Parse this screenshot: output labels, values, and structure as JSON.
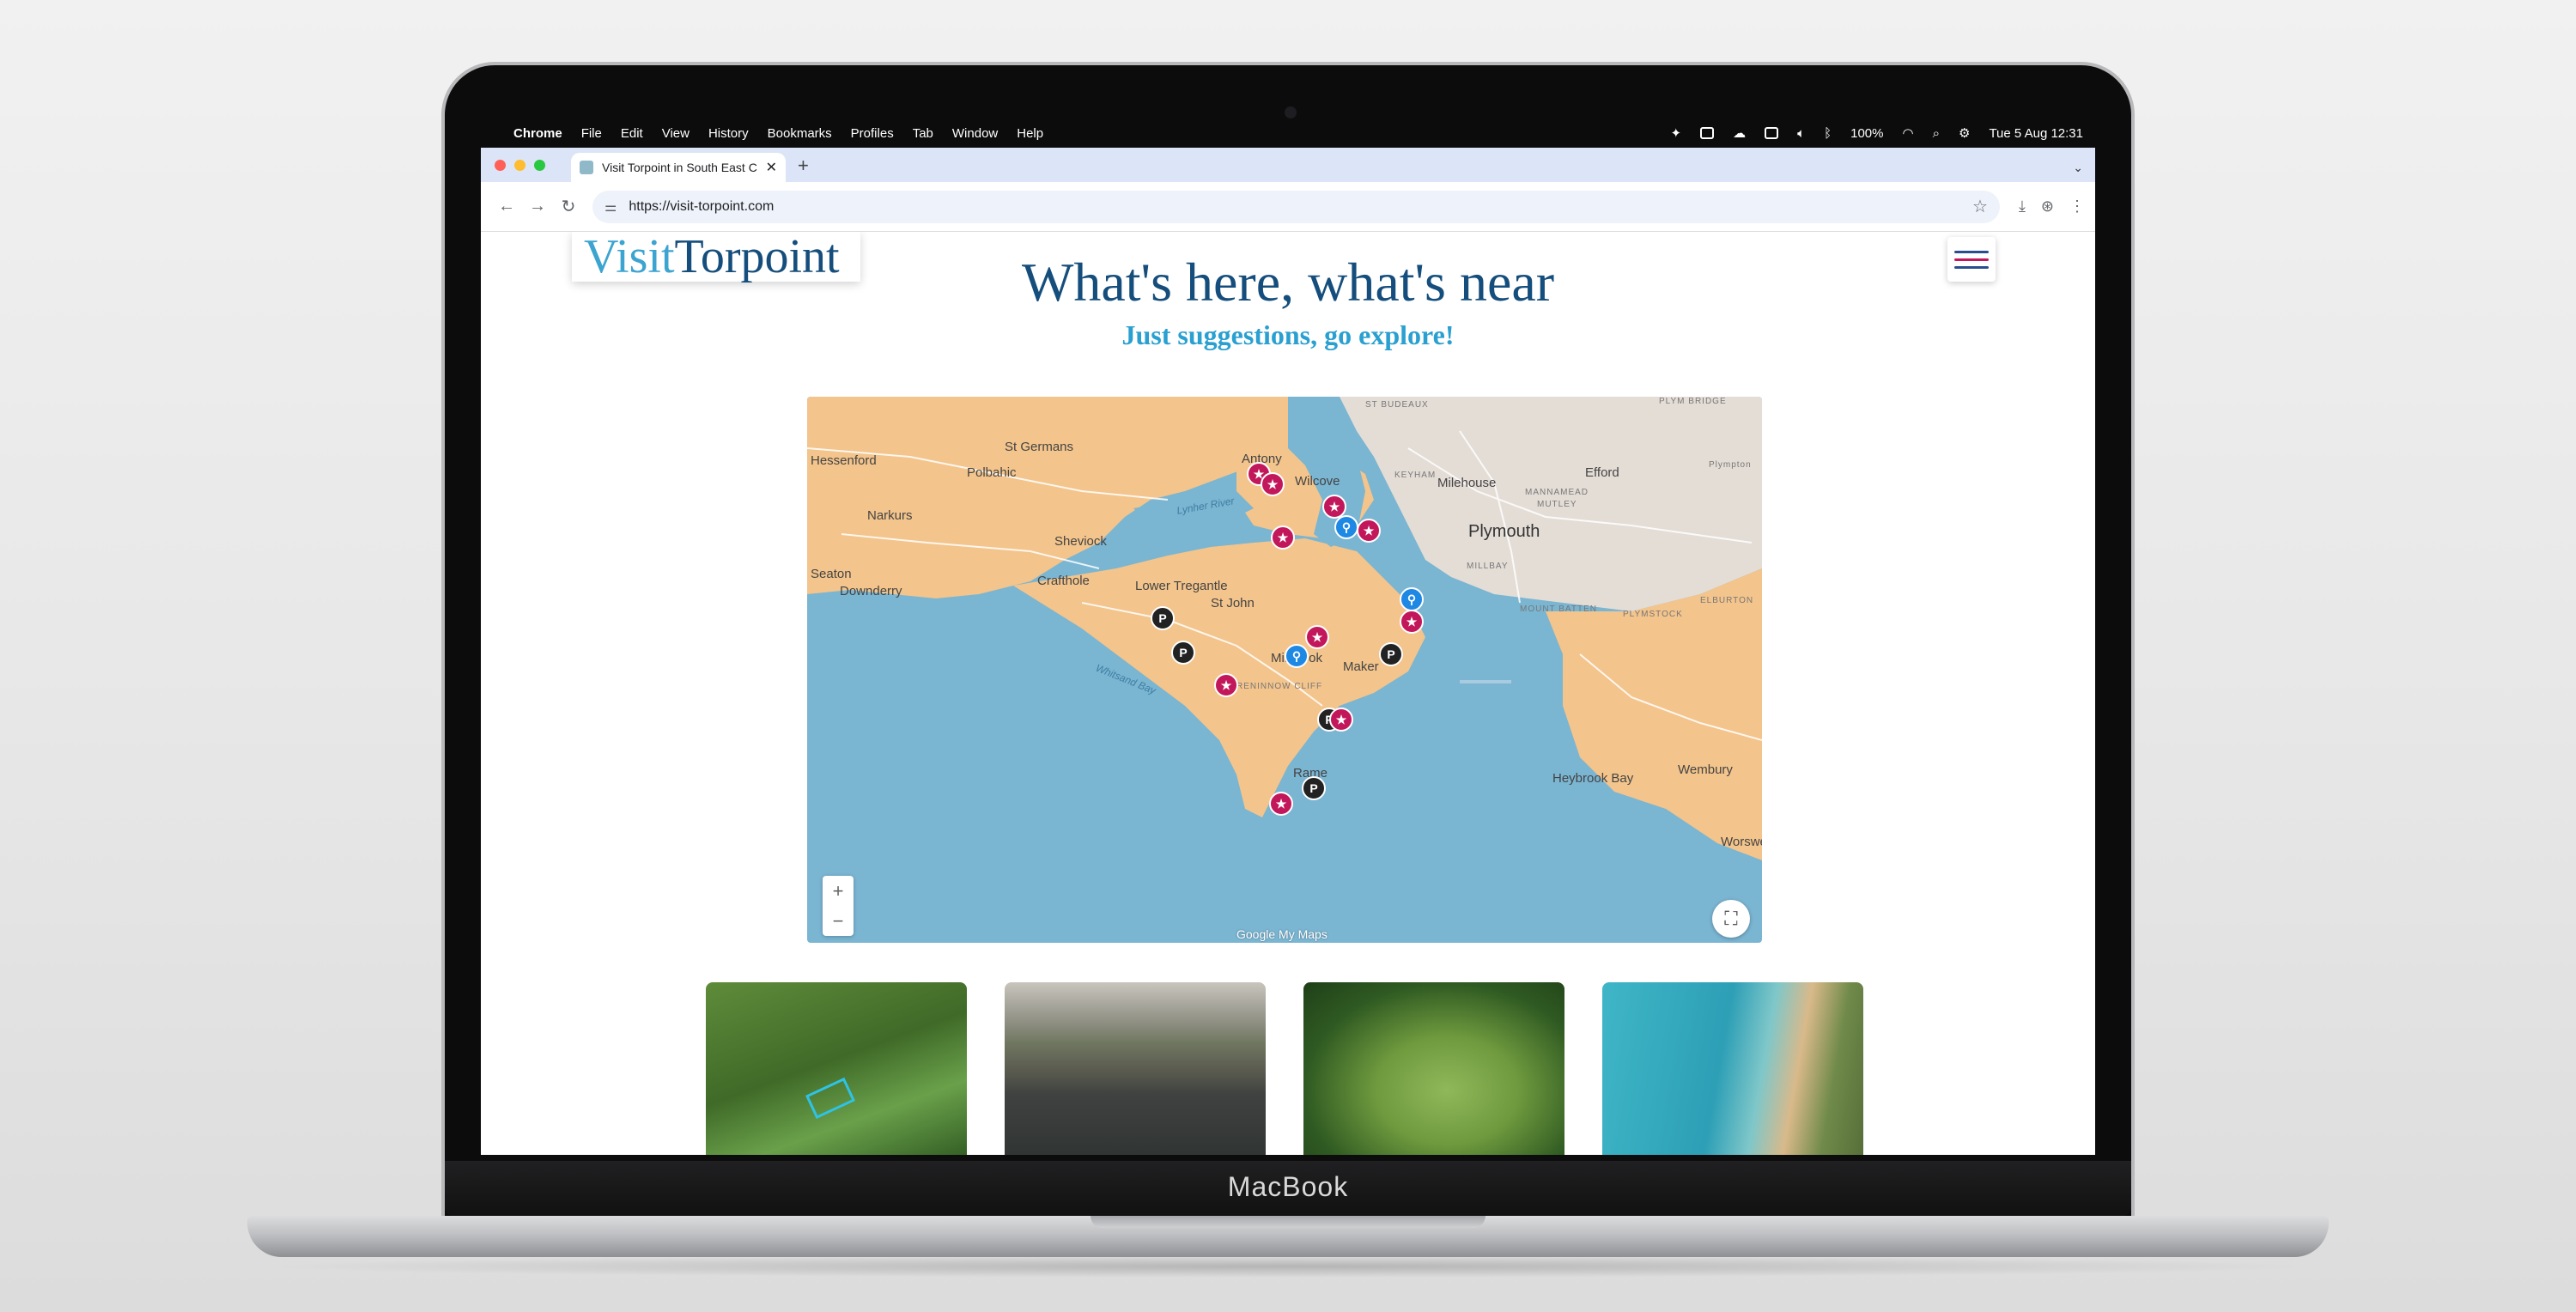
{
  "menubar": {
    "items": [
      "Chrome",
      "File",
      "Edit",
      "View",
      "History",
      "Bookmarks",
      "Profiles",
      "Tab",
      "Window",
      "Help"
    ],
    "battery": "100%",
    "datetime": "Tue 5 Aug  12:31"
  },
  "browser": {
    "tab_title": "Visit Torpoint in South East C",
    "url": "https://visit-torpoint.com"
  },
  "page": {
    "logo_part1": "Visit",
    "logo_part2": "Torpoint",
    "headline": "What's here, what's near",
    "subline": "Just suggestions, go explore!"
  },
  "map": {
    "attribution": "Google My Maps",
    "zoom_in": "+",
    "zoom_out": "−",
    "places": [
      "St Germans",
      "Hessenford",
      "Polbahic",
      "Narkurs",
      "Sheviock",
      "Crafthole",
      "Seaton",
      "Downderry",
      "Antony",
      "Wilcove",
      "Lower Tregantle",
      "St John",
      "Millbrook",
      "Maker",
      "Rame",
      "Plymouth",
      "Milehouse",
      "Efford",
      "Plympton",
      "Wembury",
      "Heybrook Bay",
      "Worswell",
      "Whitsand Bay",
      "RENINNOW CLIFF",
      "MILLBAY",
      "MOUNT BATTEN",
      "PLYMSTOCK",
      "ELBURTON",
      "ST BUDEAUX",
      "KEYHAM",
      "MANNAMEAD",
      "MUTLEY",
      "PLYM BRIDGE",
      "Lynher River",
      "Tregantle"
    ]
  },
  "colors": {
    "land": "#f3c48b",
    "urban": "#e4ddd6",
    "water": "#7ab5d2",
    "attraction_pin": "#c2185b",
    "parking_pin": "#222222",
    "toilet_pin": "#1e88e5",
    "brand_dark": "#154e7c",
    "brand_light": "#2aa0d0"
  },
  "laptop": {
    "brand": "MacBook"
  }
}
